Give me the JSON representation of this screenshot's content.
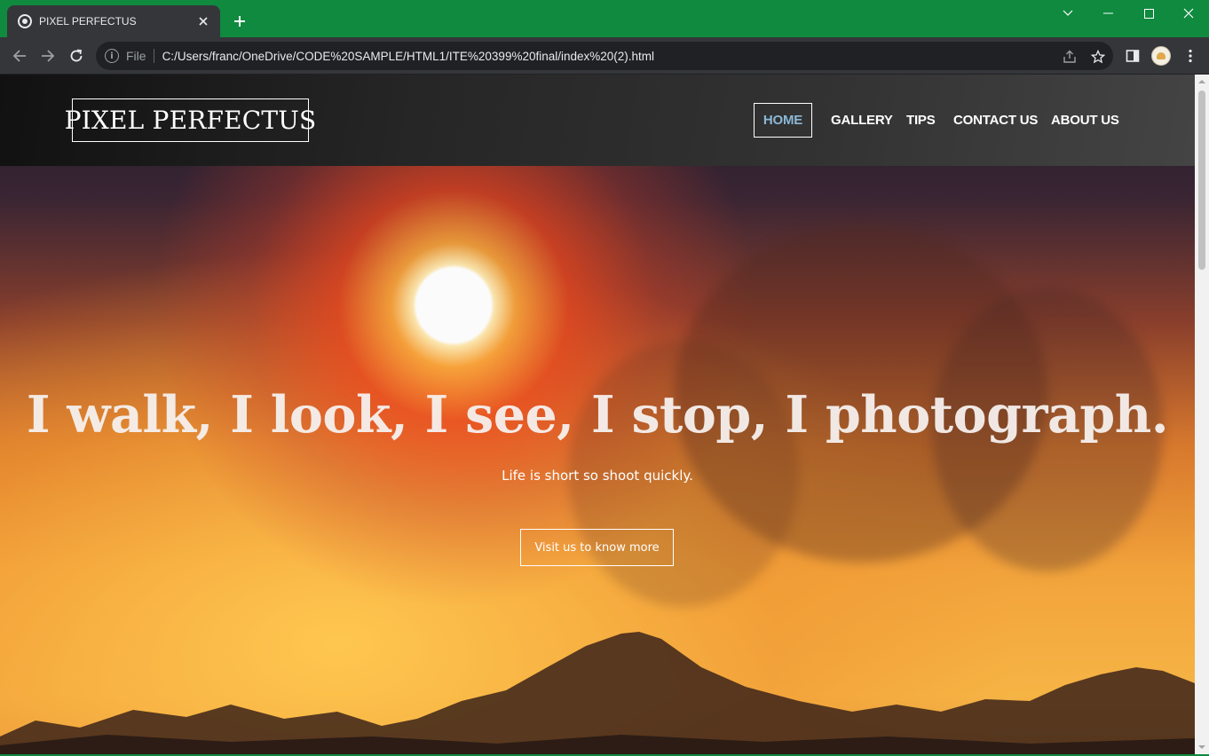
{
  "browser": {
    "tab_title": "PIXEL PERFECTUS",
    "omnibox_scheme_label": "File",
    "url": "C:/Users/franc/OneDrive/CODE%20SAMPLE/HTML1/ITE%20399%20final/index%20(2).html",
    "icons": {
      "favicon": "globe-icon",
      "tab_close": "close-icon",
      "new_tab": "plus-icon",
      "back": "arrow-left-icon",
      "forward": "arrow-right-icon",
      "reload": "reload-icon",
      "site_info": "info-icon",
      "share": "share-icon",
      "bookmark": "star-icon",
      "side_panel": "side-panel-icon",
      "menu": "kebab-menu-icon"
    },
    "colors": {
      "frame": "#0f8a3f",
      "toolbar": "#35363a",
      "omnibox": "#202124"
    }
  },
  "site": {
    "logo": "PIXEL PERFECTUS",
    "nav": {
      "home": "HOME",
      "gallery": "GALLERY",
      "tips": "TIPS",
      "contact": "CONTACT US",
      "about": "ABOUT US"
    },
    "active_nav": "home",
    "colors": {
      "active_nav_text": "#8bb7d6",
      "nav_text": "#ffffff"
    }
  },
  "hero": {
    "title": "I walk, I look, I see, I stop, I photograph.",
    "subtitle": "Life is short so shoot quickly.",
    "cta_label": "Visit us to know more"
  }
}
